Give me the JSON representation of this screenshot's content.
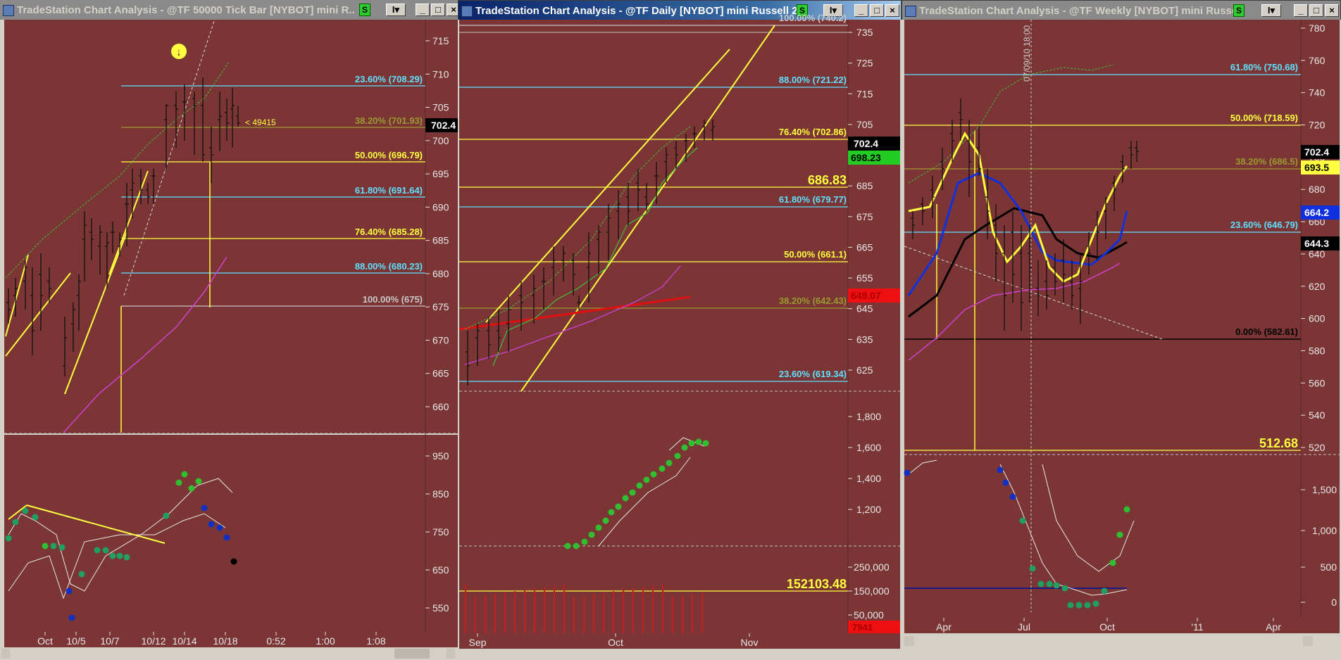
{
  "windows": [
    {
      "title": "TradeStation Chart Analysis - @TF 50000 Tick Bar [NYBOT] mini R...",
      "s_label": "S",
      "i_label": "I",
      "price_ticks": [
        "715",
        "710",
        "705",
        "700",
        "695",
        "690",
        "685",
        "680",
        "675",
        "670",
        "665",
        "660"
      ],
      "osc_ticks": [
        "950",
        "850",
        "750",
        "650",
        "550"
      ],
      "x_ticks": [
        "Oct",
        "10/5",
        "10/7",
        "10/12",
        "10/14",
        "10/18",
        "0:52",
        "1:00",
        "1:08"
      ],
      "fib": [
        {
          "text": "23.60% (708.29)",
          "color": "#5fe0ff"
        },
        {
          "text": "38.20% (701.93)",
          "color": "#9a9a30"
        },
        {
          "text": "50.00% (696.79)",
          "color": "#ffff40"
        },
        {
          "text": "61.80% (691.64)",
          "color": "#5fe0ff"
        },
        {
          "text": "76.40% (685.28)",
          "color": "#ffff40"
        },
        {
          "text": "88.00% (680.23)",
          "color": "#5fe0ff"
        },
        {
          "text": "100.00% (675)",
          "color": "#c8c8c8"
        }
      ],
      "note": "< 49415",
      "last_price": "702.4"
    },
    {
      "title": "TradeStation Chart Analysis - @TF Daily [NYBOT] mini Russell 2...",
      "s_label": "S",
      "i_label": "I",
      "price_ticks": [
        "735",
        "725",
        "715",
        "705",
        "695",
        "685",
        "675",
        "665",
        "655",
        "645",
        "635",
        "625"
      ],
      "osc_ticks": [
        "1,800",
        "1,600",
        "1,400",
        "1,200"
      ],
      "vol_ticks": [
        "250,000",
        "150,000",
        "50,000"
      ],
      "x_ticks": [
        "Sep",
        "Oct",
        "Nov"
      ],
      "fib": [
        {
          "text": "100.00% (740.2)",
          "color": "#c8c8c8"
        },
        {
          "text": "88.00% (721.22)",
          "color": "#5fe0ff"
        },
        {
          "text": "76.40% (702.86)",
          "color": "#ffff40"
        },
        {
          "text": "61.80% (679.77)",
          "color": "#5fe0ff"
        },
        {
          "text": "50.00% (661.1)",
          "color": "#ffff40"
        },
        {
          "text": "38.20% (642.43)",
          "color": "#9a9a30"
        },
        {
          "text": "23.60% (619.34)",
          "color": "#5fe0ff"
        }
      ],
      "big_label": "686.83",
      "vol_label": "152103.48",
      "badges": {
        "price": "702.4",
        "green": "698.23",
        "red": "649.07",
        "vol": "7941"
      }
    },
    {
      "title": "TradeStation Chart Analysis - @TF Weekly [NYBOT] mini Russell...",
      "s_label": "S",
      "i_label": "I",
      "price_ticks": [
        "780",
        "760",
        "740",
        "720",
        "700",
        "680",
        "660",
        "640",
        "620",
        "600",
        "580",
        "560",
        "540",
        "520"
      ],
      "osc_ticks": [
        "1,500",
        "1,000",
        "500",
        "0"
      ],
      "x_ticks": [
        "Apr",
        "Jul",
        "Oct",
        "'11",
        "Apr"
      ],
      "fib": [
        {
          "text": "61.80% (750.68)",
          "color": "#5fe0ff"
        },
        {
          "text": "50.00% (718.59)",
          "color": "#ffff40"
        },
        {
          "text": "38.20% (686.5)",
          "color": "#9a9a30"
        },
        {
          "text": "23.60% (646.79)",
          "color": "#5fe0ff"
        },
        {
          "text": "0.00% (582.61)",
          "color": "#000000"
        }
      ],
      "big_label": "512.68",
      "vert_date": "07/09/10 18:00",
      "badges": {
        "price": "702.4",
        "yellow": "693.5",
        "blue": "664.2",
        "black": "644.3"
      }
    }
  ]
}
